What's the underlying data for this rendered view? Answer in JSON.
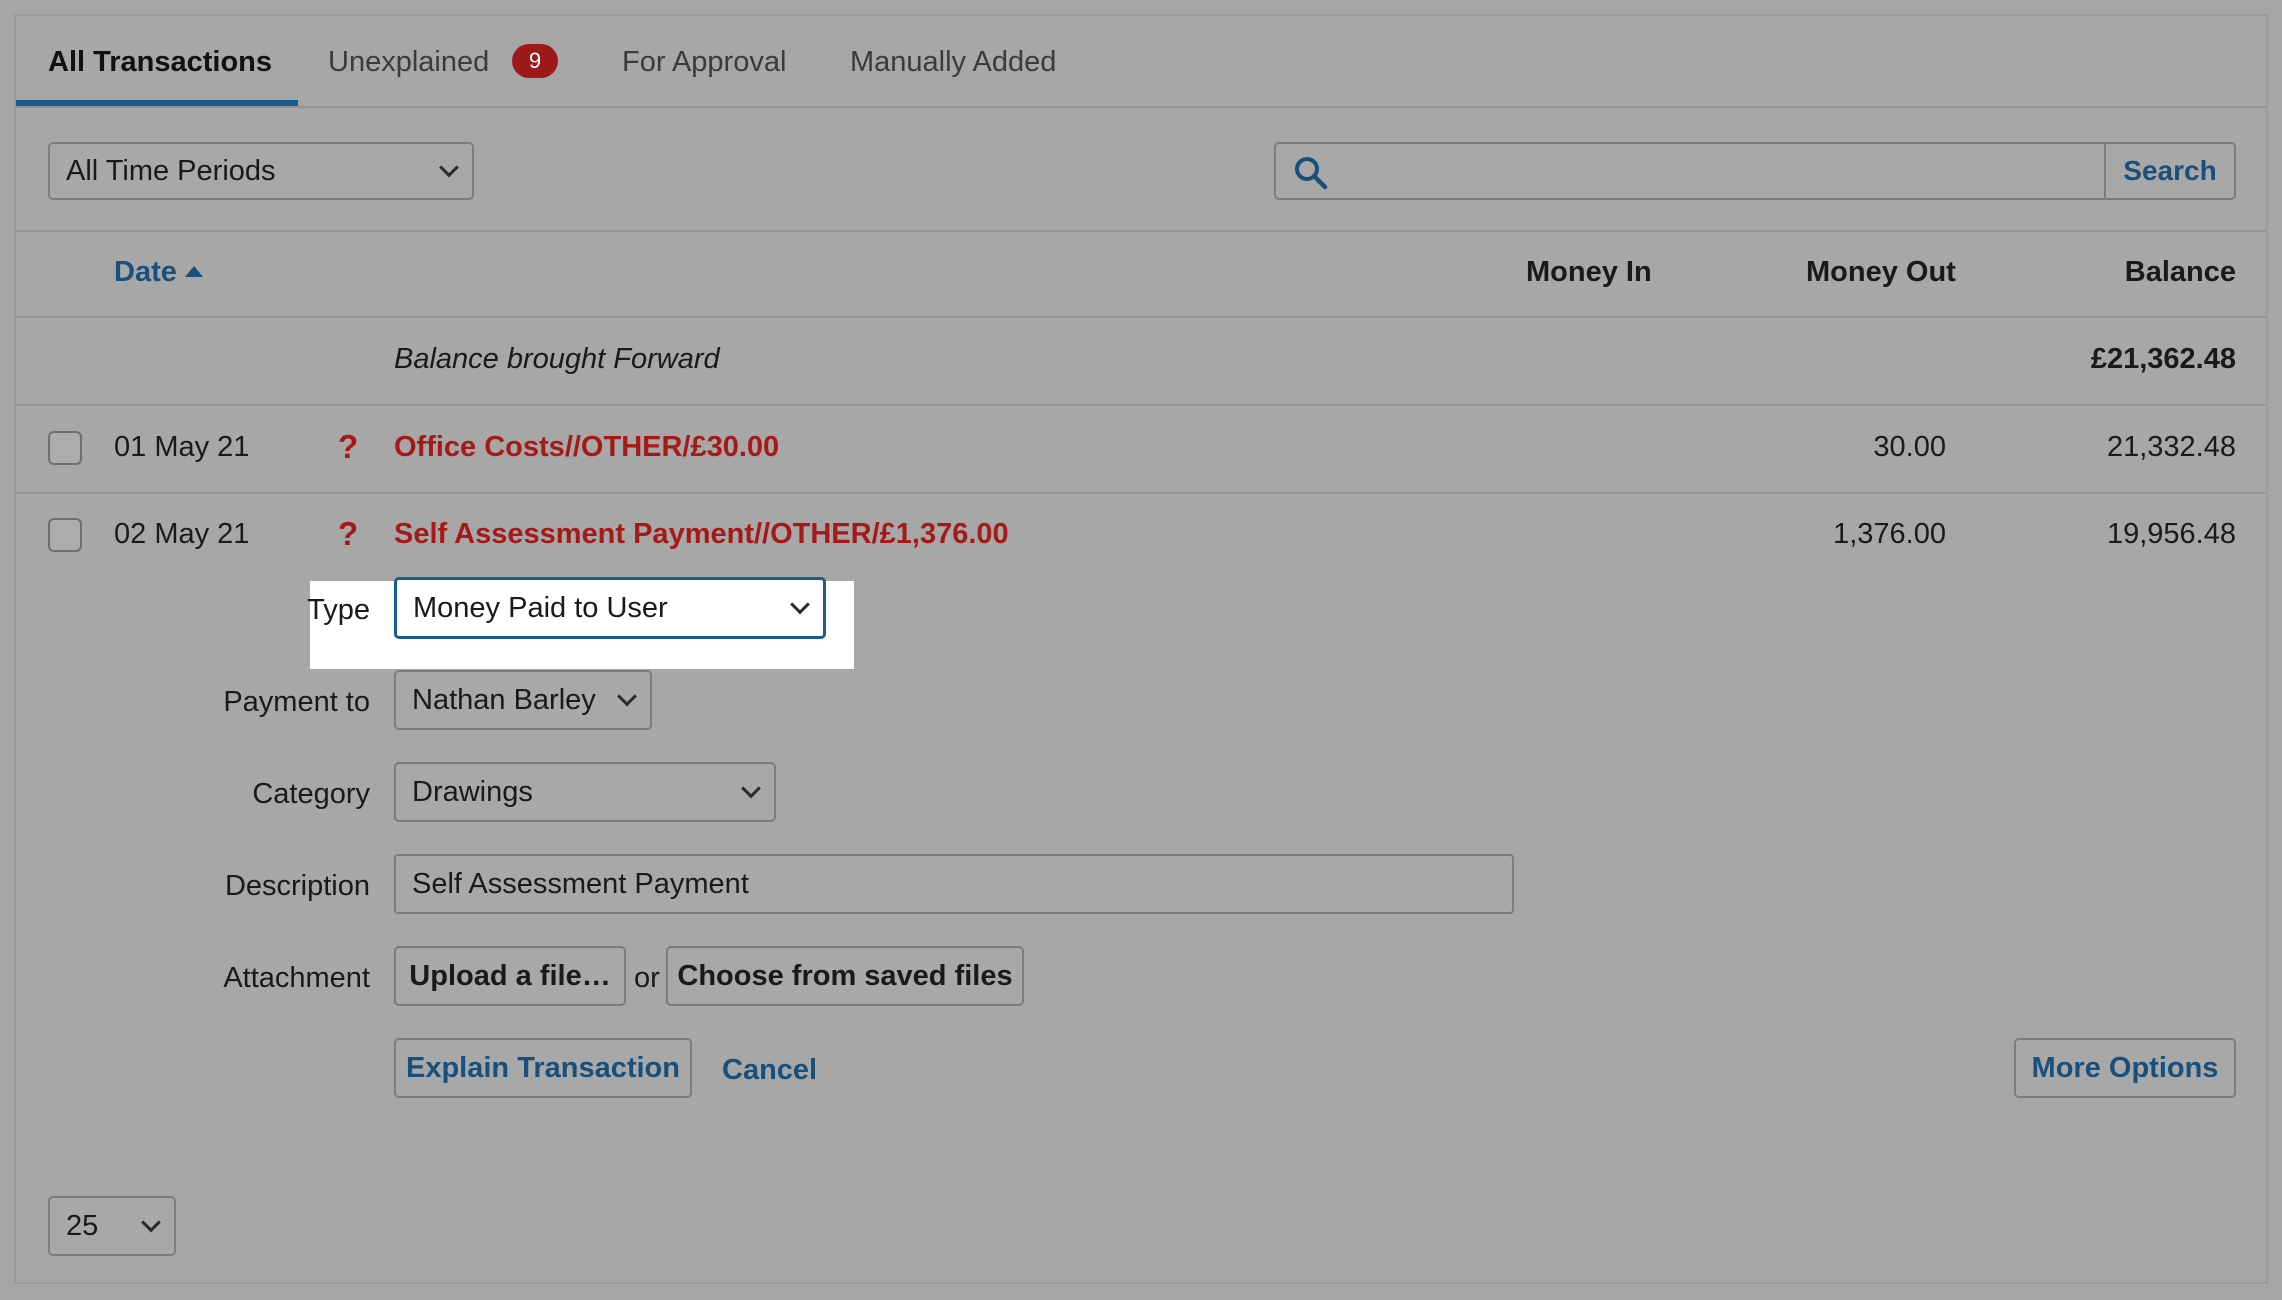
{
  "tabs": [
    {
      "label": "All Transactions",
      "active": true
    },
    {
      "label": "Unexplained",
      "badge": "9"
    },
    {
      "label": "For Approval"
    },
    {
      "label": "Manually Added"
    }
  ],
  "filters": {
    "period_selected": "All Time Periods",
    "search_placeholder": "",
    "search_button": "Search"
  },
  "table": {
    "headers": {
      "date": "Date",
      "money_in": "Money In",
      "money_out": "Money Out",
      "balance": "Balance"
    },
    "brought_forward": {
      "label": "Balance brought Forward",
      "balance": "£21,362.48"
    },
    "rows": [
      {
        "date": "01 May 21",
        "status": "?",
        "description": "Office Costs//OTHER/£30.00",
        "money_in": "",
        "money_out": "30.00",
        "balance": "21,332.48"
      },
      {
        "date": "02 May 21",
        "status": "?",
        "description": "Self Assessment Payment//OTHER/£1,376.00",
        "money_in": "",
        "money_out": "1,376.00",
        "balance": "19,956.48"
      }
    ]
  },
  "explain_form": {
    "type_label": "Type",
    "type_value": "Money Paid to User",
    "payment_to_label": "Payment to",
    "payment_to_value": "Nathan Barley",
    "category_label": "Category",
    "category_value": "Drawings",
    "description_label": "Description",
    "description_value": "Self Assessment Payment",
    "attachment_label": "Attachment",
    "upload_button": "Upload a file…",
    "or_text": "or",
    "choose_button": "Choose from saved files",
    "explain_button": "Explain Transaction",
    "cancel_link": "Cancel",
    "more_options_button": "More Options"
  },
  "pagination": {
    "per_page": "25"
  },
  "colors": {
    "accent": "#194f7c",
    "alert": "#a61919",
    "badge": "#9c1a1a"
  }
}
